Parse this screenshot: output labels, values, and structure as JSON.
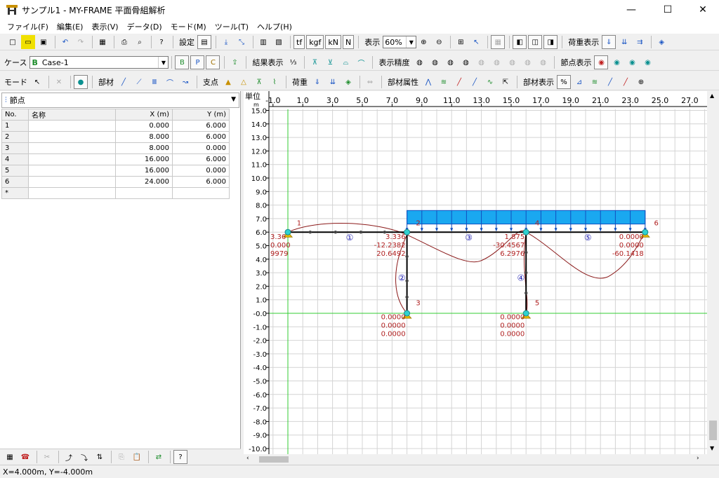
{
  "window": {
    "title": "サンプル1 - MY-FRAME 平面骨組解析",
    "minimize": "—",
    "maximize": "☐",
    "close": "✕"
  },
  "menu": [
    "ファイル(F)",
    "編集(E)",
    "表示(V)",
    "データ(D)",
    "モード(M)",
    "ツール(T)",
    "ヘルプ(H)"
  ],
  "toolbar1": {
    "settings_label": "設定",
    "units": [
      "tf",
      "kgf",
      "kN",
      "N"
    ],
    "display_label": "表示",
    "zoom_value": "60%",
    "load_display_label": "荷重表示"
  },
  "toolbar2": {
    "case_label": "ケース",
    "case_value": "Case-1",
    "case_buttons": [
      "B",
      "P",
      "C"
    ],
    "result_display_label": "結果表示",
    "result_precision_label": "表示精度",
    "node_display_label": "節点表示"
  },
  "toolbar3": {
    "mode_label": "モード",
    "member_label": "部材",
    "support_label": "支点",
    "load_label": "荷重",
    "member_attr_label": "部材属性",
    "member_display_label": "部材表示"
  },
  "panel": {
    "selector": "節点",
    "columns": [
      "No.",
      "名称",
      "X (m)",
      "Y (m)"
    ],
    "rows": [
      {
        "no": "1",
        "name": "",
        "x": "0.000",
        "y": "6.000"
      },
      {
        "no": "2",
        "name": "",
        "x": "8.000",
        "y": "6.000"
      },
      {
        "no": "3",
        "name": "",
        "x": "8.000",
        "y": "0.000"
      },
      {
        "no": "4",
        "name": "",
        "x": "16.000",
        "y": "6.000"
      },
      {
        "no": "5",
        "name": "",
        "x": "16.000",
        "y": "0.000"
      },
      {
        "no": "6",
        "name": "",
        "x": "24.000",
        "y": "6.000"
      }
    ],
    "new_row": "*"
  },
  "canvas": {
    "unit_label": "単位",
    "unit_sub": "m",
    "x_ticks": [
      "-1.0",
      "1.0",
      "3.0",
      "5.0",
      "7.0",
      "9.0",
      "11.0",
      "13.0",
      "15.0",
      "17.0",
      "19.0",
      "21.0",
      "23.0",
      "25.0",
      "27.0"
    ],
    "y_ticks": [
      "15.0",
      "14.0",
      "13.0",
      "12.0",
      "11.0",
      "10.0",
      "9.0",
      "8.0",
      "7.0",
      "6.0",
      "5.0",
      "4.0",
      "3.0",
      "2.0",
      "1.0",
      "-0.0",
      "-1.0",
      "-2.0",
      "-3.0",
      "-4.0",
      "-5.0",
      "-6.0",
      "-7.0",
      "-8.0",
      "-9.0",
      "-10.0"
    ],
    "node_labels": [
      "1",
      "2",
      "3",
      "4",
      "5",
      "6"
    ],
    "member_labels": [
      "①",
      "②",
      "③",
      "④",
      "⑤"
    ],
    "values_node1": [
      "3.36",
      "0.000",
      "9979"
    ],
    "values_node2": [
      "3.336",
      "-12.2382",
      "20.6492"
    ],
    "values_node4": [
      "1.875",
      "-30.4567",
      "6.2976"
    ],
    "values_node6": [
      "0.0000",
      "0.0000",
      "-60.1418"
    ],
    "values_node3": [
      "0.0000",
      "0.0000",
      "0.0000"
    ],
    "values_node5": [
      "0.0000",
      "0.0000",
      "0.0000"
    ],
    "colors": {
      "grid": "#d4d4d4",
      "axis": "#33cc33",
      "frame": "#000000",
      "load": "#1aa8f0",
      "load_edge": "#1050c0",
      "moment": "#8b1a1a",
      "support": "#f0c000",
      "node": "#30d0d0",
      "label_red": "#b02020",
      "label_blue": "#2020b0"
    }
  },
  "status": {
    "coords": "X=4.000m, Y=-4.000m"
  }
}
